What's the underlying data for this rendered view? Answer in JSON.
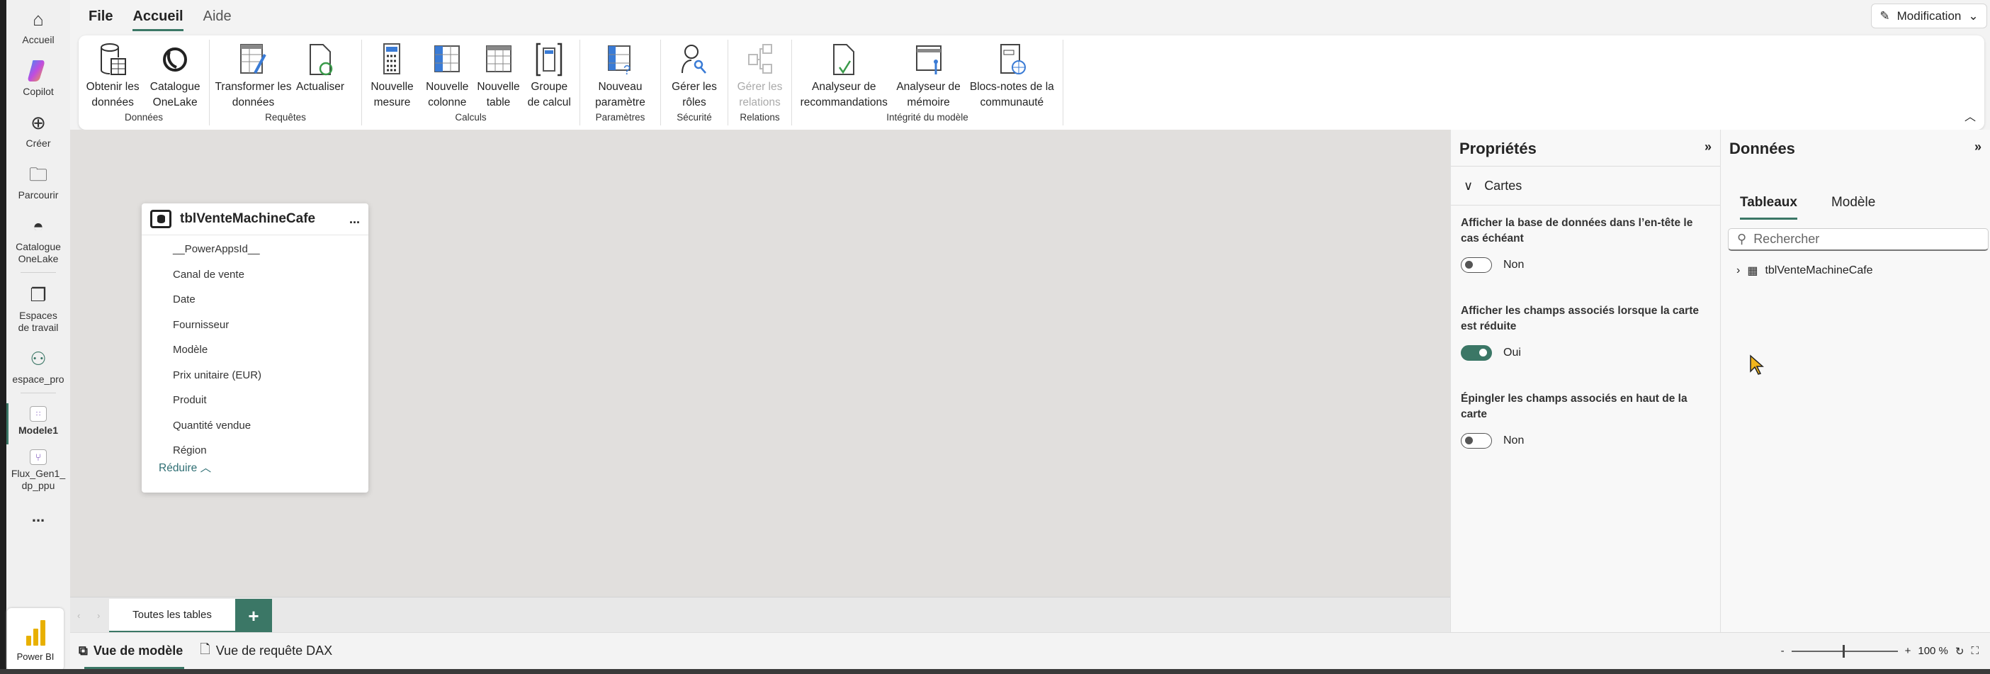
{
  "nav": {
    "items": [
      {
        "label": "Accueil",
        "icon": "home-icon"
      },
      {
        "label": "Copilot",
        "icon": "copilot-icon"
      },
      {
        "label": "Créer",
        "icon": "plus-circle-icon"
      },
      {
        "label": "Parcourir",
        "icon": "folder-icon"
      },
      {
        "label": "Catalogue OneLake",
        "icon": "onelake-icon"
      },
      {
        "label": "Espaces de travail",
        "icon": "workspaces-icon"
      },
      {
        "label": "espace_pro",
        "icon": "group-icon"
      },
      {
        "label": "Modele1",
        "icon": "semantic-model-icon"
      },
      {
        "label": "Flux_Gen1_dp_ppu",
        "icon": "dataflow-icon"
      }
    ],
    "more": "...",
    "app": "Power BI"
  },
  "ribbon": {
    "tabs": [
      "File",
      "Accueil",
      "Aide"
    ],
    "mode": "Modification",
    "groups": [
      {
        "label": "Données",
        "buttons": [
          "Obtenir les données",
          "Catalogue OneLake"
        ]
      },
      {
        "label": "Requêtes",
        "buttons": [
          "Transformer les données",
          "Actualiser"
        ]
      },
      {
        "label": "Calculs",
        "buttons": [
          "Nouvelle mesure",
          "Nouvelle colonne",
          "Nouvelle table",
          "Groupe de calcul"
        ]
      },
      {
        "label": "Paramètres",
        "buttons": [
          "Nouveau paramètre"
        ]
      },
      {
        "label": "Sécurité",
        "buttons": [
          "Gérer les rôles"
        ]
      },
      {
        "label": "Relations",
        "buttons": [
          "Gérer les relations"
        ]
      },
      {
        "label": "Intégrité du modèle",
        "buttons": [
          "Analyseur de recommandations",
          "Analyseur de mémoire",
          "Blocs-notes de la communauté"
        ]
      }
    ]
  },
  "card": {
    "title": "tblVenteMachineCafe",
    "more": "...",
    "fields": [
      "__PowerAppsId__",
      "Canal de vente",
      "Date",
      "Fournisseur",
      "Modèle",
      "Prix unitaire (EUR)",
      "Produit",
      "Quantité vendue",
      "Région"
    ],
    "collapse": "Réduire"
  },
  "tabbar": {
    "tab": "Toutes les tables",
    "add": "+"
  },
  "properties": {
    "title": "Propriétés",
    "section": "Cartes",
    "options": [
      {
        "label": "Afficher la base de données dans l’en-tête le cas échéant",
        "value": "Non",
        "on": false
      },
      {
        "label": "Afficher les champs associés lorsque la carte est réduite",
        "value": "Oui",
        "on": true
      },
      {
        "label": "Épingler les champs associés en haut de la carte",
        "value": "Non",
        "on": false
      }
    ]
  },
  "data": {
    "title": "Données",
    "tabs": [
      "Tableaux",
      "Modèle"
    ],
    "search_placeholder": "Rechercher",
    "tables": [
      "tblVenteMachineCafe"
    ]
  },
  "status": {
    "views": [
      "Vue de modèle",
      "Vue de requête DAX"
    ],
    "zoom": "100 %"
  },
  "colors": {
    "accent": "#3b7766",
    "canvas": "#e1dfdd"
  }
}
